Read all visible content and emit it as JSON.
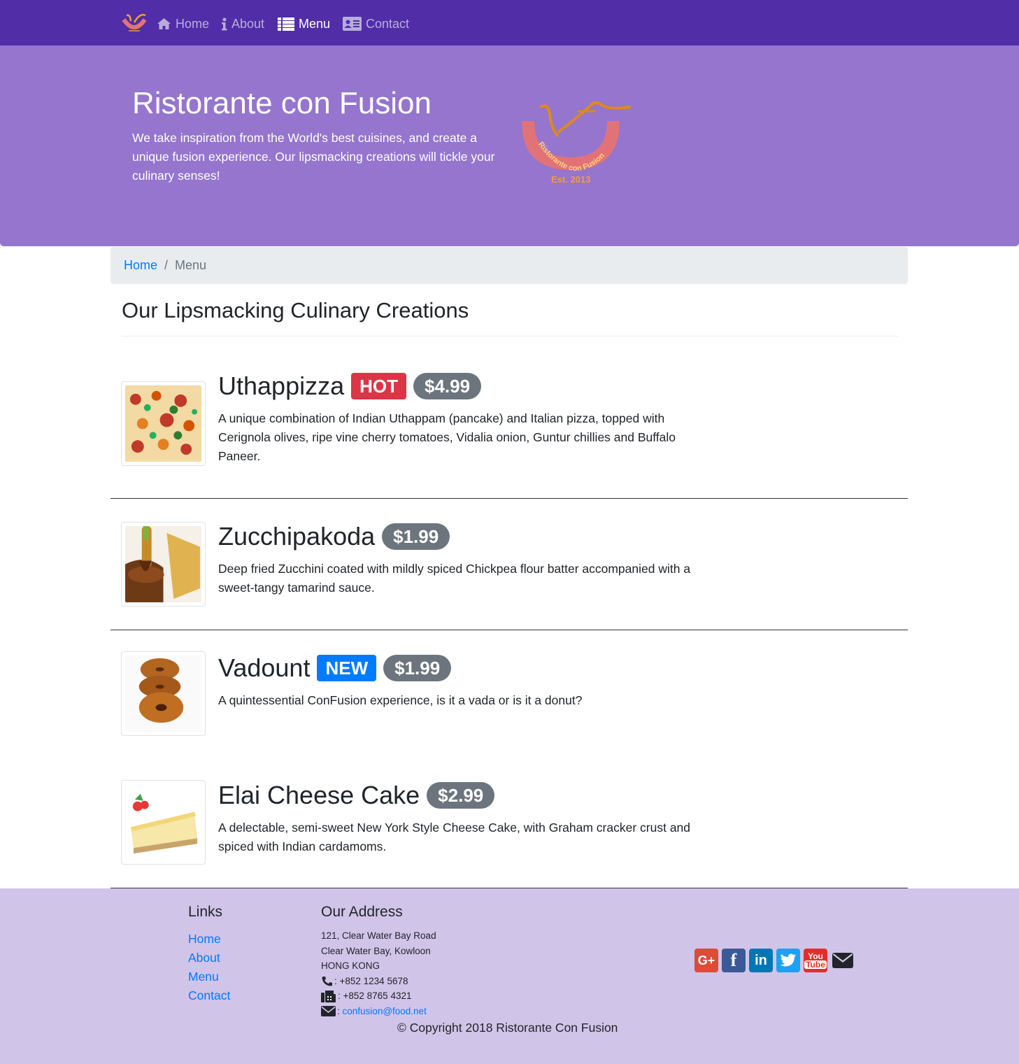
{
  "nav": {
    "logo_icon": "restaurant-logo",
    "items": [
      {
        "label": "Home",
        "icon": "home-icon",
        "active": false
      },
      {
        "label": "About",
        "icon": "info-icon",
        "active": false
      },
      {
        "label": "Menu",
        "icon": "list-icon",
        "active": true
      },
      {
        "label": "Contact",
        "icon": "address-card-icon",
        "active": false
      }
    ]
  },
  "jumbotron": {
    "title": "Ristorante con Fusion",
    "text": "We take inspiration from the World's best cuisines, and create a unique fusion experience. Our lipsmacking creations will tickle your culinary senses!",
    "logo_ring_text": "Ristorante con Fusion",
    "logo_est_text": "Est. 2013"
  },
  "breadcrumb": {
    "home": "Home",
    "separator": "/",
    "active": "Menu"
  },
  "heading": "Our Lipsmacking Culinary Creations",
  "dishes": [
    {
      "name": "Uthappizza",
      "label": "HOT",
      "price": "$4.99",
      "description": "A unique combination of Indian Uthappam (pancake) and Italian pizza, topped with Cerignola olives, ripe vine cherry tomatoes, Vidalia onion, Guntur chillies and Buffalo Paneer."
    },
    {
      "name": "Zucchipakoda",
      "label": "",
      "price": "$1.99",
      "description": "Deep fried Zucchini coated with mildly spiced Chickpea flour batter accompanied with a sweet-tangy tamarind sauce."
    },
    {
      "name": "Vadount",
      "label": "NEW",
      "price": "$1.99",
      "description": "A quintessential ConFusion experience, is it a vada or is it a donut?"
    },
    {
      "name": "Elai Cheese Cake",
      "label": "",
      "price": "$2.99",
      "description": "A delectable, semi-sweet New York Style Cheese Cake, with Graham cracker crust and spiced with Indian cardamoms."
    }
  ],
  "footer": {
    "links_heading": "Links",
    "links": [
      "Home",
      "About",
      "Menu",
      "Contact"
    ],
    "address_heading": "Our Address",
    "address_lines": [
      "121, Clear Water Bay Road",
      "Clear Water Bay, Kowloon",
      "HONG KONG"
    ],
    "phone": ": +852 1234 5678",
    "fax": ": +852 8765 4321",
    "email_prefix": ":",
    "email": "confusion@food.net",
    "social": [
      "google-plus-icon",
      "facebook-icon",
      "linkedin-icon",
      "twitter-icon",
      "youtube-icon",
      "envelope-icon"
    ],
    "youtube_top": "You",
    "youtube_bottom": "Tube",
    "copyright": "© Copyright 2018 Ristorante Con Fusion"
  },
  "colors": {
    "primary": "#512DA8",
    "jumbotron": "#9575CD",
    "footer": "#D1C4E9",
    "hot": "#dc3545",
    "new": "#007bff",
    "price": "#6c757d",
    "link": "#007bff"
  }
}
